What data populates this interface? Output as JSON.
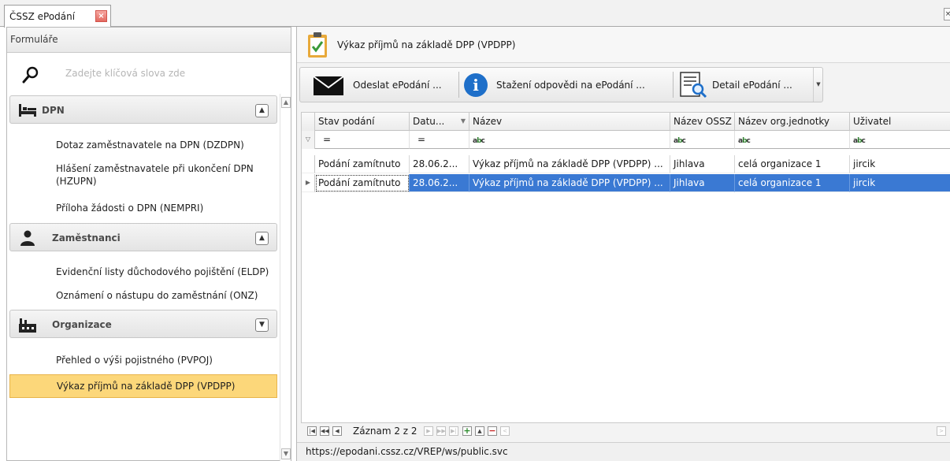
{
  "tab": {
    "title": "ČSSZ ePodání",
    "close": "×",
    "strip_close": "×"
  },
  "sidebar": {
    "header": "Formuláře",
    "search_placeholder": "Zadejte klíčová slova zde",
    "groups": [
      {
        "label": "DPN",
        "icon": "bed-icon",
        "state": "^",
        "items": [
          "Dotaz zaměstnavatele na DPN (DZDPN)",
          "Hlášení zaměstnavatele při ukončení DPN (HZUPN)",
          "Příloha žádosti o DPN (NEMPRI)"
        ]
      },
      {
        "label": "Zaměstnanci",
        "icon": "person-icon",
        "state": "^",
        "items": [
          "Evidenční listy důchodového pojištění (ELDP)",
          "Oznámení o nástupu do zaměstnání (ONZ)"
        ]
      },
      {
        "label": "Organizace",
        "icon": "factory-icon",
        "state": "v",
        "items": [
          "Přehled o výši pojistného (PVPOJ)",
          "Výkaz příjmů na základě DPP (VPDPP)"
        ],
        "selected_index": 1
      }
    ]
  },
  "main": {
    "title": "Výkaz příjmů na základě DPP (VPDPP)",
    "toolbar": {
      "send": "Odeslat ePodání ...",
      "download": "Stažení odpovědi na ePodání ...",
      "detail": "Detail ePodání ...",
      "info_glyph": "i"
    },
    "grid": {
      "columns": [
        "Stav podání",
        "Datu...",
        "Název",
        "Název OSSZ",
        "Název org.jednotky",
        "Uživatel"
      ],
      "filters": [
        "=",
        "=",
        "abc",
        "abc",
        "abc",
        "abc"
      ],
      "rows": [
        [
          "Podání zamítnuto",
          "28.06.2...",
          "Výkaz příjmů na základě DPP (VPDPP) ...",
          "Jihlava",
          "celá organizace 1",
          "jircik"
        ],
        [
          "Podání zamítnuto",
          "28.06.2...",
          "Výkaz příjmů na základě DPP (VPDPP) ...",
          "Jihlava",
          "celá organizace 1",
          "jircik"
        ]
      ],
      "selected_row": 1
    },
    "navigator": {
      "text": "Záznam 2 z 2"
    },
    "status_url": "https://epodani.cssz.cz/VREP/ws/public.svc"
  }
}
